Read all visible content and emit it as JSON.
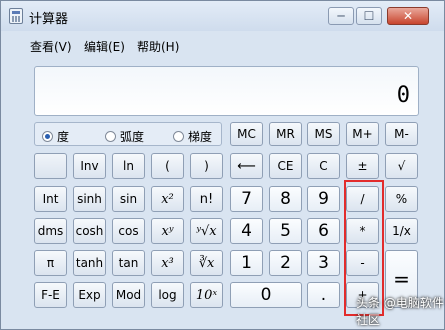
{
  "window": {
    "title": "计算器",
    "min": "─",
    "max": "☐",
    "close": "✕"
  },
  "menu": [
    "查看(V)",
    "编辑(E)",
    "帮助(H)"
  ],
  "display": {
    "value": "0"
  },
  "angle_modes": [
    {
      "label": "度",
      "selected": true
    },
    {
      "label": "弧度",
      "selected": false
    },
    {
      "label": "梯度",
      "selected": false
    }
  ],
  "memory": [
    "MC",
    "MR",
    "MS",
    "M+",
    "M-"
  ],
  "row2": {
    "blank": "",
    "inv": "Inv",
    "ln": "ln",
    "lparen": "(",
    "rparen": ")",
    "back": "⟵",
    "ce": "CE",
    "c": "C",
    "plusminus": "±",
    "sqrt": "√"
  },
  "row3": {
    "int": "Int",
    "sinh": "sinh",
    "sin": "sin",
    "x2": "x²",
    "fact": "n!",
    "n7": "7",
    "n8": "8",
    "n9": "9",
    "div": "/",
    "pct": "%"
  },
  "row4": {
    "dms": "dms",
    "cosh": "cosh",
    "cos": "cos",
    "xy": "xʸ",
    "yroot": "ʸ√x",
    "n4": "4",
    "n5": "5",
    "n6": "6",
    "mul": "*",
    "recip": "1/x"
  },
  "row5": {
    "pi": "π",
    "tanh": "tanh",
    "tan": "tan",
    "x3": "x³",
    "croot": "∛x",
    "n1": "1",
    "n2": "2",
    "n3": "3",
    "sub": "-",
    "eq": "="
  },
  "row6": {
    "fe": "F-E",
    "exp": "Exp",
    "mod": "Mod",
    "log": "log",
    "tenx": "10ˣ",
    "n0": "0",
    "dot": ".",
    "add": "+"
  },
  "watermark": "头条 @电脑软件社区"
}
